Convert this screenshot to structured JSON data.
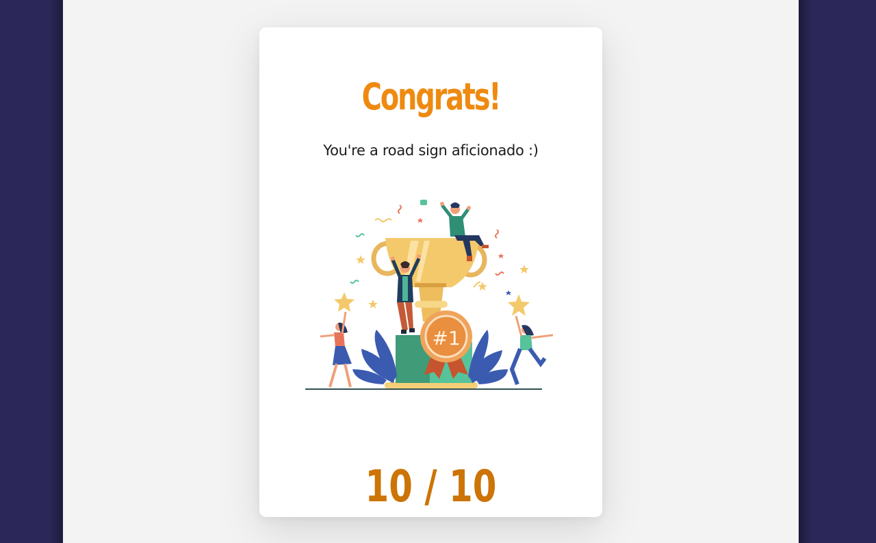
{
  "result": {
    "title": "Congrats!",
    "message": "You're a road sign aficionado :)",
    "badge": "#1",
    "score": {
      "correct": 10,
      "total": 10,
      "display": "10 / 10"
    }
  },
  "colors": {
    "background": "#2b2859",
    "page": "#f3f3f3",
    "card": "#ffffff",
    "title": "#ee8a10",
    "score": "#cc7406"
  }
}
